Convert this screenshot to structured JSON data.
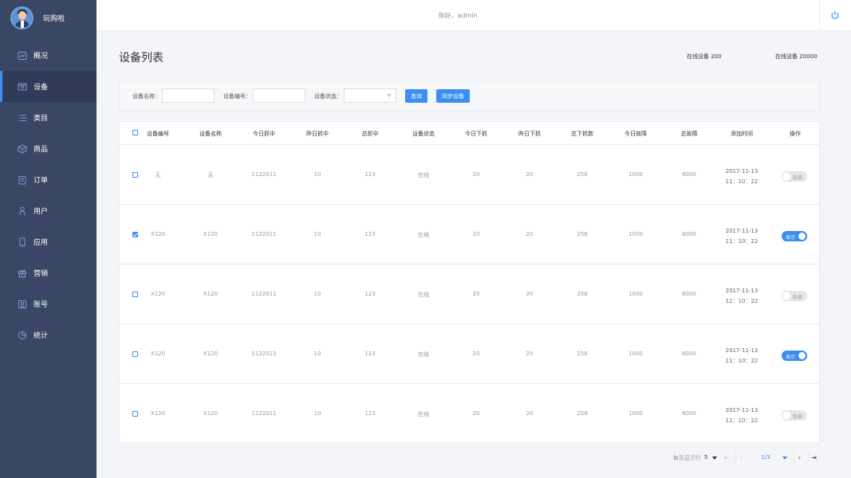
{
  "brand": {
    "name": "玩购啦"
  },
  "nav": [
    {
      "label": "概况",
      "icon": "chart-icon"
    },
    {
      "label": "设备",
      "icon": "device-icon",
      "active": true
    },
    {
      "label": "类目",
      "icon": "list-icon"
    },
    {
      "label": "商品",
      "icon": "box-icon"
    },
    {
      "label": "订单",
      "icon": "order-icon"
    },
    {
      "label": "用户",
      "icon": "user-icon"
    },
    {
      "label": "应用",
      "icon": "phone-icon"
    },
    {
      "label": "营销",
      "icon": "gift-icon"
    },
    {
      "label": "账号",
      "icon": "account-icon"
    },
    {
      "label": "统计",
      "icon": "stats-icon"
    }
  ],
  "topbar": {
    "greeting": "你好，admin"
  },
  "page": {
    "title": "设备列表",
    "stat_online_1": "在线设备 200",
    "stat_online_2": "在线设备 20000"
  },
  "filter": {
    "name_label": "设备名称：",
    "name_value": "",
    "code_label": "设备编号：",
    "code_value": "",
    "status_label": "设备状态：",
    "status_value": "",
    "query_button": "查询",
    "sync_button": "同步设备"
  },
  "table": {
    "headers": [
      "设备编号",
      "设备名称",
      "今日抓中",
      "昨日抓中",
      "总抓中",
      "设备状态",
      "今日下抓",
      "昨日下抓",
      "总下抓数",
      "今日故障",
      "总故障",
      "添加时间",
      "操作"
    ],
    "rows": [
      {
        "checked": false,
        "code": "无",
        "name": "无",
        "today_catch": "1122011",
        "yest_catch": "10",
        "total_catch": "123",
        "status": "在线",
        "today_down": "20",
        "yest_down": "20",
        "total_down": "258",
        "today_fault": "1000",
        "total_fault": "6000",
        "date": "2017-11-13",
        "time": "11：10：22",
        "toggle_on": false,
        "toggle_label": "隐藏"
      },
      {
        "checked": true,
        "code": "X120",
        "name": "X120",
        "today_catch": "1122011",
        "yest_catch": "10",
        "total_catch": "123",
        "status": "在线",
        "today_down": "20",
        "yest_down": "20",
        "total_down": "258",
        "today_fault": "1000",
        "total_fault": "6000",
        "date": "2017-11-13",
        "time": "11：10：22",
        "toggle_on": true,
        "toggle_label": "显示"
      },
      {
        "checked": false,
        "code": "X120",
        "name": "X120",
        "today_catch": "1122011",
        "yest_catch": "10",
        "total_catch": "123",
        "status": "在线",
        "today_down": "20",
        "yest_down": "20",
        "total_down": "258",
        "today_fault": "1000",
        "total_fault": "6000",
        "date": "2017-11-13",
        "time": "11：10：22",
        "toggle_on": false,
        "toggle_label": "隐藏"
      },
      {
        "checked": false,
        "code": "X120",
        "name": "X120",
        "today_catch": "1122011",
        "yest_catch": "10",
        "total_catch": "123",
        "status": "在线",
        "today_down": "20",
        "yest_down": "20",
        "total_down": "258",
        "today_fault": "1000",
        "total_fault": "6000",
        "date": "2017-11-13",
        "time": "11：10：22",
        "toggle_on": true,
        "toggle_label": "显示"
      },
      {
        "checked": false,
        "code": "X120",
        "name": "X120",
        "today_catch": "1122011",
        "yest_catch": "10",
        "total_catch": "123",
        "status": "在线",
        "today_down": "20",
        "yest_down": "20",
        "total_down": "258",
        "today_fault": "1000",
        "total_fault": "6000",
        "date": "2017-11-13",
        "time": "11：10：22",
        "toggle_on": false,
        "toggle_label": "隐藏"
      }
    ]
  },
  "pagination": {
    "per_page_label": "每页显示行",
    "per_page_value": "5",
    "page_indicator": "1/3"
  },
  "colors": {
    "sidebar": "#394664",
    "accent": "#3a8ef5"
  }
}
